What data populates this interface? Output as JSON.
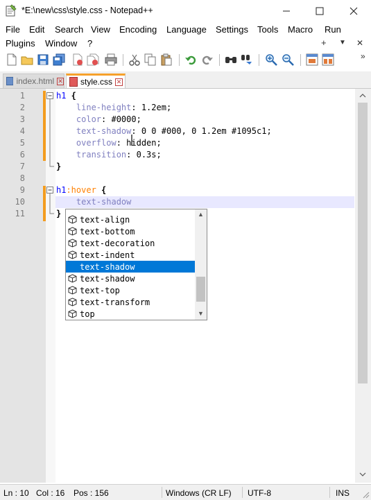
{
  "window": {
    "title": "*E:\\new\\css\\style.css - Notepad++",
    "minimize_glyph": "—",
    "maximize_glyph": "☐",
    "close_glyph": "✕"
  },
  "menu": {
    "row1": [
      "File",
      "Edit",
      "Search",
      "View",
      "Encoding",
      "Language",
      "Settings",
      "Tools",
      "Macro",
      "Run"
    ],
    "row2": [
      "Plugins",
      "Window",
      "?"
    ],
    "plus": "+",
    "dropdown": "▼",
    "close": "✕"
  },
  "toolbar": {
    "icons": [
      "new-file-icon",
      "open-file-icon",
      "save-icon",
      "save-all-icon",
      "close-icon",
      "close-all-icon",
      "print-icon",
      "cut-icon",
      "copy-icon",
      "paste-icon",
      "undo-icon",
      "redo-icon",
      "find-icon",
      "replace-icon",
      "zoom-in-icon",
      "zoom-out-icon",
      "sync-vertical-icon",
      "sync-horizontal-icon"
    ],
    "overflow": "»"
  },
  "tabs": [
    {
      "label": "index.html",
      "active": false
    },
    {
      "label": "style.css",
      "active": true
    }
  ],
  "editor": {
    "line_numbers": [
      "1",
      "2",
      "3",
      "4",
      "5",
      "6",
      "7",
      "8",
      "9",
      "10",
      "11"
    ],
    "lines": [
      [
        {
          "t": "h1",
          "c": "#0000ff",
          "b": false
        },
        {
          "t": " {",
          "c": "#000000",
          "b": true
        }
      ],
      [
        {
          "t": "    line-height",
          "c": "#8080c0",
          "b": false
        },
        {
          "t": ": 1.2em;",
          "c": "#000000",
          "b": false
        }
      ],
      [
        {
          "t": "    color",
          "c": "#8080c0",
          "b": false
        },
        {
          "t": ": #0000;",
          "c": "#000000",
          "b": false
        }
      ],
      [
        {
          "t": "    text-shadow",
          "c": "#8080c0",
          "b": false
        },
        {
          "t": ": 0 0 #000, 0 1.2em #1095c1;",
          "c": "#000000",
          "b": false
        }
      ],
      [
        {
          "t": "    overflow",
          "c": "#8080c0",
          "b": false
        },
        {
          "t": ": hidden;",
          "c": "#000000",
          "b": false
        }
      ],
      [
        {
          "t": "    transition",
          "c": "#8080c0",
          "b": false
        },
        {
          "t": ": 0.3s;",
          "c": "#000000",
          "b": false
        }
      ],
      [
        {
          "t": "}",
          "c": "#000000",
          "b": true
        }
      ],
      [],
      [
        {
          "t": "h1",
          "c": "#0000ff",
          "b": false
        },
        {
          "t": ":hover",
          "c": "#ff8000",
          "b": false
        },
        {
          "t": " {",
          "c": "#000000",
          "b": true
        }
      ],
      [
        {
          "t": "    text-shadow",
          "c": "#8080c0",
          "b": false
        }
      ],
      [
        {
          "t": "}",
          "c": "#000000",
          "b": true
        }
      ]
    ]
  },
  "autocomplete": {
    "items": [
      "text-align",
      "text-bottom",
      "text-decoration",
      "text-indent",
      "text-shadow",
      "text-shadow",
      "text-top",
      "text-transform",
      "top"
    ],
    "selected_index": 4,
    "scroll_up": "▲",
    "scroll_down": "▼"
  },
  "status": {
    "ln": "Ln : 10",
    "col": "Col : 16",
    "pos": "Pos : 156",
    "eol": "Windows (CR LF)",
    "encoding": "UTF-8",
    "mode": "INS"
  },
  "colors": {
    "selector": "#0000ff",
    "property": "#8080c0",
    "pseudo": "#ff8000",
    "change_marker": "#f39c1f",
    "tab_accent": "#f6a12b",
    "selection": "#0078d7"
  }
}
